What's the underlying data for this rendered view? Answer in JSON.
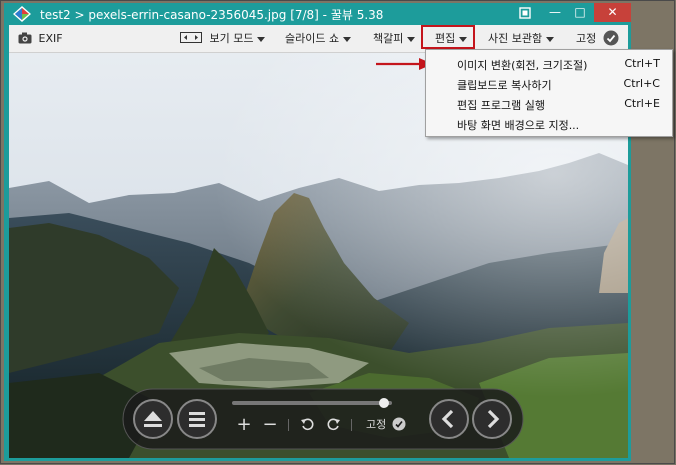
{
  "window": {
    "title": "test2  >  pexels-errin-casano-2356045.jpg  [7/8]  -  꿀뷰 5.38",
    "controls": {
      "minimize": "—",
      "maximize": "□",
      "close": "✕"
    }
  },
  "toolbar": {
    "exif": "EXIF",
    "view_mode": "보기 모드",
    "slideshow": "슬라이드 쇼",
    "bookmark": "책갈피",
    "edit": "편집",
    "photo_storage": "사진 보관함",
    "pin": "고정"
  },
  "edit_menu": {
    "items": [
      {
        "label": "이미지 변환(회전, 크기조절)",
        "shortcut": "Ctrl+T"
      },
      {
        "label": "클립보드로 복사하기",
        "shortcut": "Ctrl+C"
      },
      {
        "label": "편집 프로그램 실행",
        "shortcut": "Ctrl+E"
      },
      {
        "label": "바탕 화면 배경으로 지정...",
        "shortcut": ""
      }
    ]
  },
  "controls": {
    "pin_label": "고정",
    "zoom_in": "+",
    "zoom_out": "−",
    "position_fraction": 0.98
  },
  "colors": {
    "window_frame": "#1d9c9b",
    "close_button": "#c7413a",
    "highlight": "#c4151c"
  }
}
